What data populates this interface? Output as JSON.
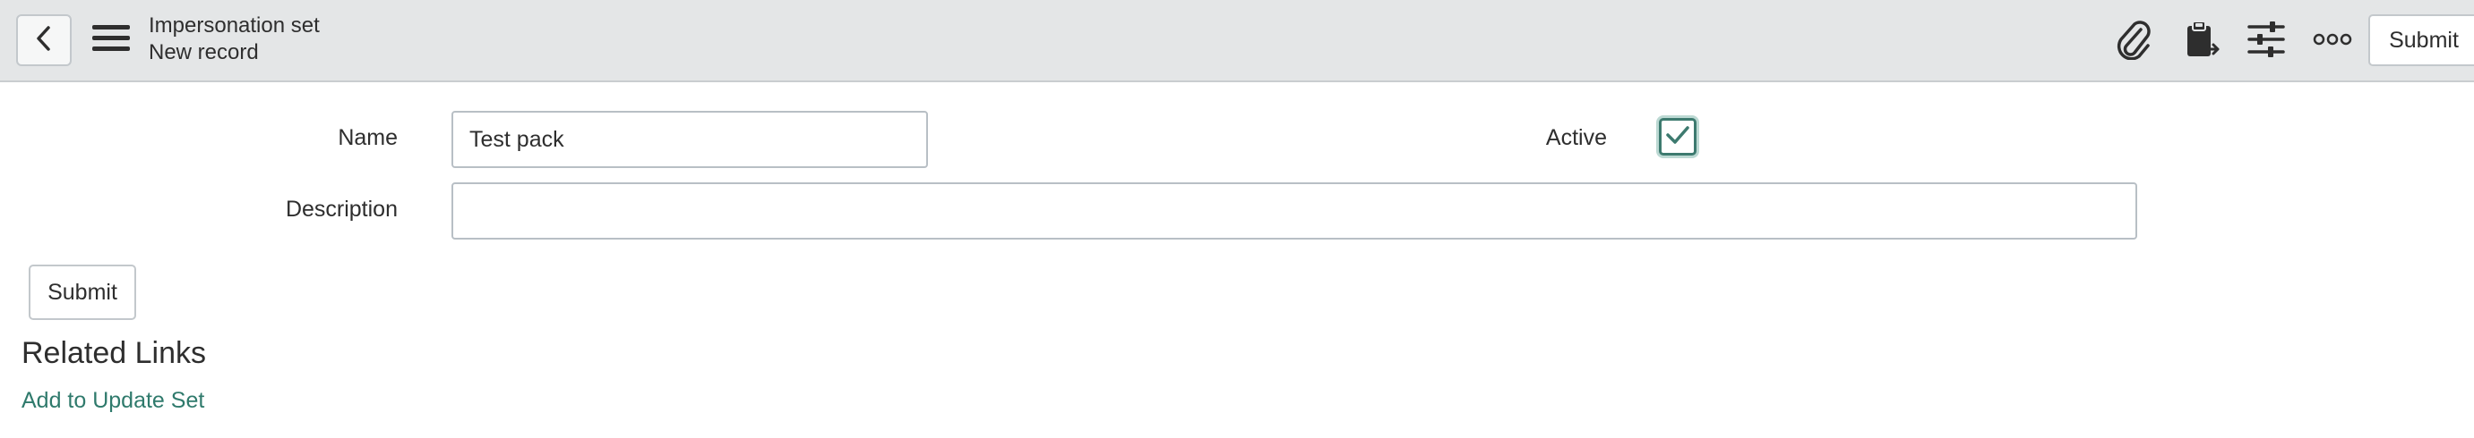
{
  "header": {
    "title": "Impersonation set",
    "subtitle": "New record",
    "back_icon": "chevron-left-icon",
    "menu_icon": "hamburger-icon",
    "actions": [
      {
        "icon": "paperclip-icon"
      },
      {
        "icon": "clipboard-icon"
      },
      {
        "icon": "sliders-icon"
      },
      {
        "icon": "more-icon"
      }
    ],
    "submit_label": "Submit"
  },
  "form": {
    "name_label": "Name",
    "name_value": "Test pack",
    "description_label": "Description",
    "description_value": "",
    "active_label": "Active",
    "active_checked": true,
    "submit_label": "Submit"
  },
  "related": {
    "title": "Related Links",
    "links": [
      "Add to Update Set"
    ]
  },
  "colors": {
    "header_bg": "#e4e6e7",
    "accent": "#2f7a6c",
    "checkbox_border": "#3d7a6f"
  }
}
